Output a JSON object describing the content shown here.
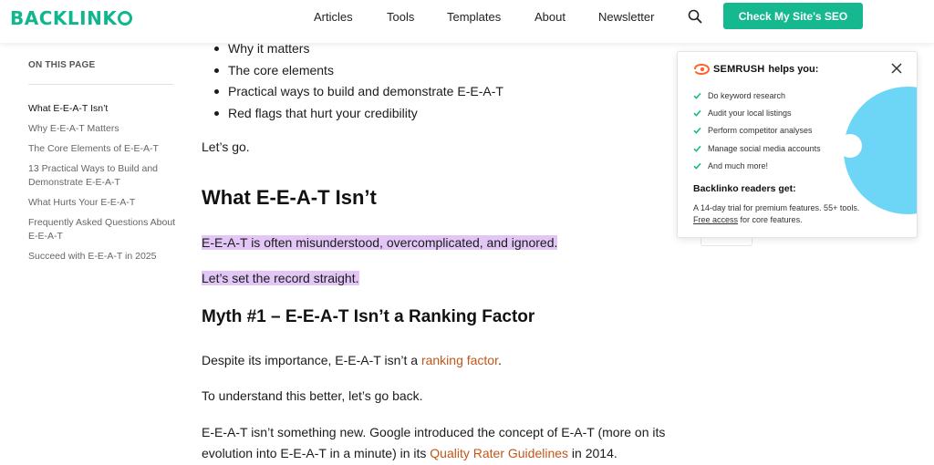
{
  "header": {
    "logo_prefix": "BACKLINK",
    "nav": [
      "Articles",
      "Tools",
      "Templates",
      "About",
      "Newsletter"
    ],
    "search_icon": "search-icon",
    "cta_label": "Check My Site's SEO",
    "accent_color": "#15b88f"
  },
  "toc": {
    "heading": "ON THIS PAGE",
    "items": [
      "What E-E-A-T Isn’t",
      "Why E-E-A-T Matters",
      "The Core Elements of E-E-A-T",
      "13 Practical Ways to Build and Demonstrate E-E-A-T",
      "What Hurts Your E-E-A-T",
      "Frequently Asked Questions About E-E-A-T",
      "Succeed with E-E-A-T in 2025"
    ],
    "active_index": 0
  },
  "article": {
    "bullets": [
      "Why it matters",
      "The core elements",
      "Practical ways to build and demonstrate E-E-A-T",
      "Red flags that hurt your credibility"
    ],
    "lets_go": "Let’s go.",
    "h2": "What E-E-A-T Isn’t",
    "highlight1": "E-E-A-T is often misunderstood, overcomplicated, and ignored.",
    "highlight2": "Let’s set the record straight.",
    "h3": "Myth #1 – E-E-A-T Isn’t a Ranking Factor",
    "p1_before": "Despite its importance, E-E-A-T isn’t a ",
    "p1_link": "ranking factor",
    "p1_after": ".",
    "p2": "To understand this better, let’s go back.",
    "p3_before": "E-E-A-T isn’t something new. Google introduced the concept of E-A-T (more on its evolution into E-E-A-T in a minute) in its ",
    "p3_link": "Quality Rater Guidelines",
    "p3_after": " in 2014.",
    "link_color": "#c2561a",
    "highlight_color": "#e2c6f6"
  },
  "popup": {
    "brand": "SEMRUSH",
    "brand_tail": "helps you:",
    "features": [
      "Do keyword research",
      "Audit your local listings",
      "Perform competitor analyses",
      "Manage social media accounts",
      "And much more!"
    ],
    "readers_heading": "Backlinko readers get:",
    "readers_line1": "A 14-day trial for premium features. 55+ tools.",
    "readers_link": "Free access",
    "readers_line2_tail": " for core features.",
    "close_icon": "close-icon",
    "check_color": "#15b88f",
    "blob_color": "#6dd6f7"
  }
}
